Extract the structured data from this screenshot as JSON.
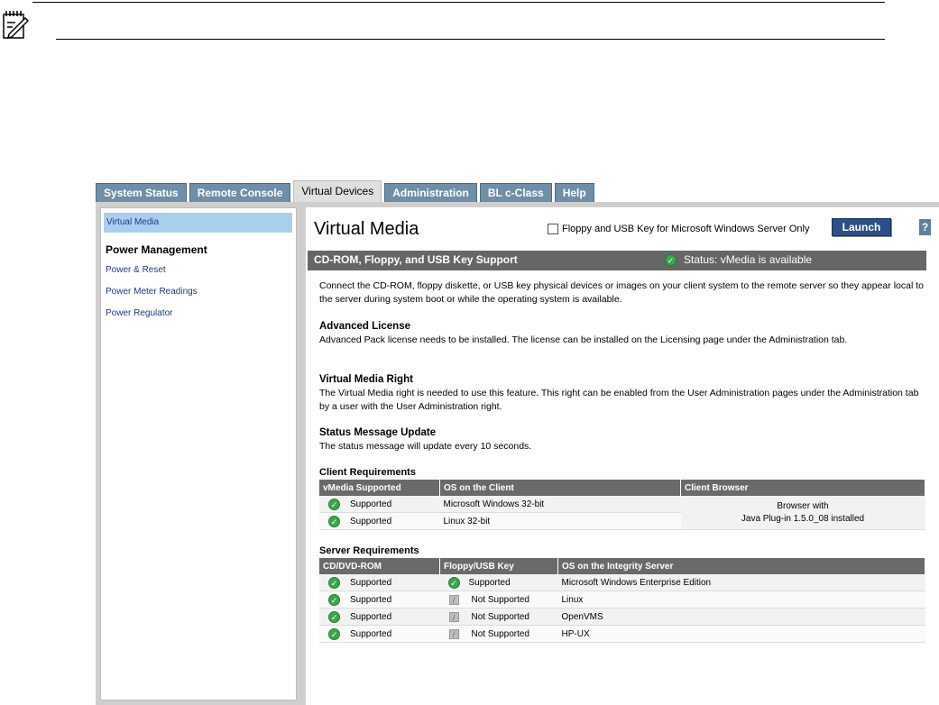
{
  "tabs": [
    {
      "label": "System Status",
      "active": false
    },
    {
      "label": "Remote Console",
      "active": false
    },
    {
      "label": "Virtual Devices",
      "active": true
    },
    {
      "label": "Administration",
      "active": false
    },
    {
      "label": "BL c-Class",
      "active": false
    },
    {
      "label": "Help",
      "active": false
    }
  ],
  "sidebar": {
    "active_item": "Virtual Media",
    "heading": "Power Management",
    "links": [
      "Power & Reset",
      "Power Meter Readings",
      "Power Regulator"
    ]
  },
  "main": {
    "title": "Virtual Media",
    "floppy_option": "Floppy and USB Key for Microsoft Windows Server Only",
    "launch_label": "Launch",
    "help_label": "?",
    "section_title": "CD-ROM, Floppy, and USB Key Support",
    "status_text": "Status: vMedia is available",
    "intro": "Connect the CD-ROM, floppy diskette, or USB key physical devices or images on your client system to the remote server so they appear local to the server during system boot or while the operating system is available.",
    "advanced_title": "Advanced License",
    "advanced_text": "Advanced Pack license needs to be installed. The license can be installed on the Licensing page under the Administration tab.",
    "right_title": "Virtual Media Right",
    "right_text": "The Virtual Media right is needed to use this feature. This right can be enabled from the User Administration pages under the Administration tab by a user with the User Administration right.",
    "update_title": "Status Message Update",
    "update_text": "The status message will update every 10 seconds."
  },
  "client_req": {
    "title": "Client Requirements",
    "headers": [
      "vMedia Supported",
      "OS on the Client",
      "Client Browser"
    ],
    "rows": [
      {
        "supported": "Supported",
        "os": "Microsoft Windows 32-bit"
      },
      {
        "supported": "Supported",
        "os": "Linux 32-bit"
      }
    ],
    "browser_line1": "Browser with",
    "browser_line2": "Java Plug-in 1.5.0_08 installed"
  },
  "server_req": {
    "title": "Server Requirements",
    "headers": [
      "CD/DVD-ROM",
      "Floppy/USB Key",
      "OS on the Integrity Server"
    ],
    "rows": [
      {
        "cd": "Supported",
        "floppy": "Supported",
        "floppy_ok": true,
        "os": "Microsoft Windows Enterprise Edition"
      },
      {
        "cd": "Supported",
        "floppy": "Not Supported",
        "floppy_ok": false,
        "os": "Linux"
      },
      {
        "cd": "Supported",
        "floppy": "Not Supported",
        "floppy_ok": false,
        "os": "OpenVMS"
      },
      {
        "cd": "Supported",
        "floppy": "Not Supported",
        "floppy_ok": false,
        "os": "HP-UX"
      }
    ]
  },
  "colors": {
    "tab": "#6f8fa9",
    "launch": "#2b4f86",
    "ok": "#3aa74a",
    "header_bar": "#666666"
  },
  "icons": {
    "note": "note-pencil-icon",
    "ok": "check-circle-icon",
    "not_supported": "not-supported-icon"
  }
}
